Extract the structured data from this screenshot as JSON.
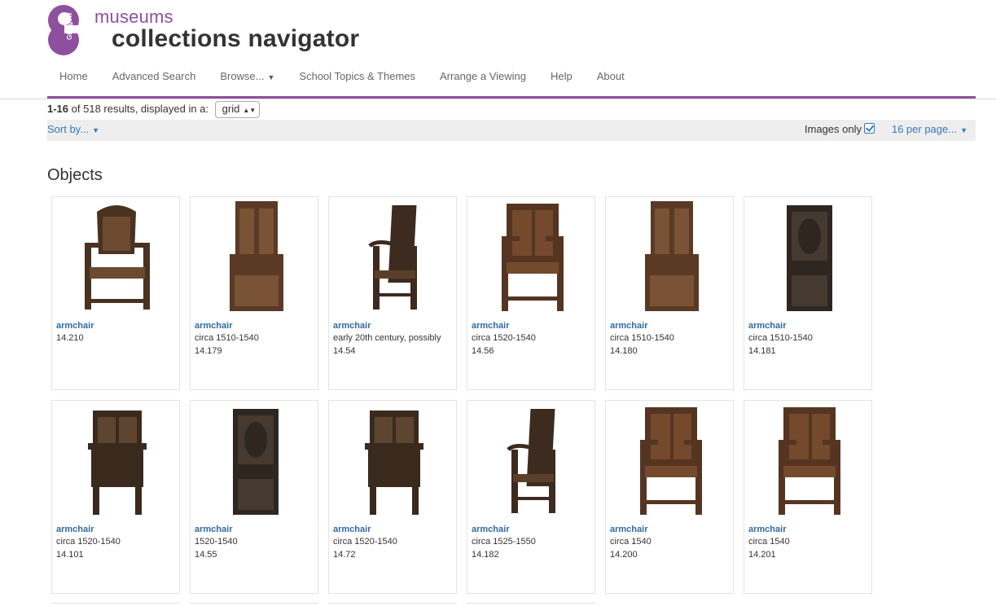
{
  "header": {
    "logo_word": "museums",
    "logo_title": "collections navigator",
    "logo_mark_text": "Glasgow",
    "brand_color": "#8e4f9e"
  },
  "nav": [
    {
      "label": "Home",
      "name": "nav-home"
    },
    {
      "label": "Advanced Search",
      "name": "nav-advanced-search"
    },
    {
      "label": "Browse...",
      "name": "nav-browse",
      "dropdown": true
    },
    {
      "label": "School Topics & Themes",
      "name": "nav-school-topics"
    },
    {
      "label": "Arrange a Viewing",
      "name": "nav-arrange-viewing"
    },
    {
      "label": "Help",
      "name": "nav-help"
    },
    {
      "label": "About",
      "name": "nav-about"
    }
  ],
  "results": {
    "range": "1-16",
    "of_text": "of 518 results, displayed in a:",
    "display_value": "grid"
  },
  "toolbar": {
    "sort_label": "Sort by...",
    "images_only_label": "Images only",
    "images_only_checked": true,
    "per_page_label": "16 per page..."
  },
  "section_heading": "Objects",
  "items": [
    {
      "name": "armchair",
      "date": "",
      "accession": "14.210",
      "variant": 1
    },
    {
      "name": "armchair",
      "date": "circa 1510-1540",
      "accession": "14.179",
      "variant": 2
    },
    {
      "name": "armchair",
      "date": "early 20th century, possibly",
      "accession": "14.54",
      "variant": 3
    },
    {
      "name": "armchair",
      "date": "circa 1520-1540",
      "accession": "14.56",
      "variant": 4
    },
    {
      "name": "armchair",
      "date": "circa 1510-1540",
      "accession": "14.180",
      "variant": 2
    },
    {
      "name": "armchair",
      "date": "circa 1510-1540",
      "accession": "14.181",
      "variant": 5
    },
    {
      "name": "armchair",
      "date": "circa 1520-1540",
      "accession": "14.101",
      "variant": 6
    },
    {
      "name": "armchair",
      "date": "1520-1540",
      "accession": "14.55",
      "variant": 5
    },
    {
      "name": "armchair",
      "date": "circa 1520-1540",
      "accession": "14.72",
      "variant": 6
    },
    {
      "name": "armchair",
      "date": "circa 1525-1550",
      "accession": "14.182",
      "variant": 3
    },
    {
      "name": "armchair",
      "date": "circa 1540",
      "accession": "14.200",
      "variant": 4
    },
    {
      "name": "armchair",
      "date": "circa 1540",
      "accession": "14.201",
      "variant": 4
    }
  ]
}
